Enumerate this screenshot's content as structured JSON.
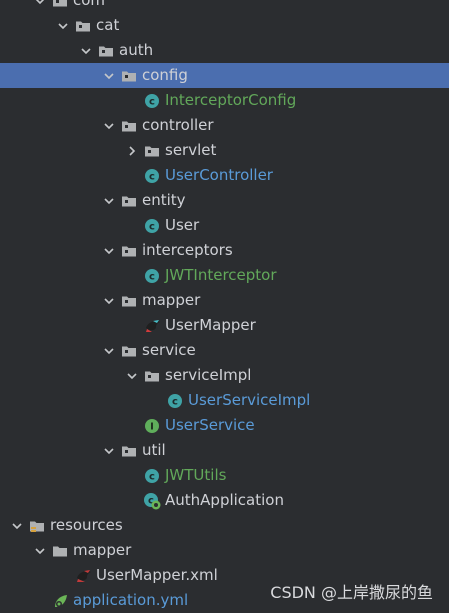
{
  "colors": {
    "background": "#2b2d30",
    "selection": "#4b6eaf",
    "text": "#cfd1d6",
    "file_blue": "#5a9bd8",
    "file_green": "#62a85a",
    "class_icon": "#3fa3a6",
    "interface_icon": "#5fae5b"
  },
  "tree": [
    {
      "label": "com",
      "depth": 1,
      "expanded": true,
      "icon": "package-folder-icon",
      "color": "default"
    },
    {
      "label": "cat",
      "depth": 2,
      "expanded": true,
      "icon": "package-folder-icon",
      "color": "default"
    },
    {
      "label": "auth",
      "depth": 3,
      "expanded": true,
      "icon": "package-folder-icon",
      "color": "default"
    },
    {
      "label": "config",
      "depth": 4,
      "expanded": true,
      "icon": "package-folder-icon",
      "color": "default",
      "selected": true
    },
    {
      "label": "InterceptorConfig",
      "depth": 5,
      "icon": "class-icon",
      "color": "green"
    },
    {
      "label": "controller",
      "depth": 4,
      "expanded": true,
      "icon": "package-folder-icon",
      "color": "default"
    },
    {
      "label": "servlet",
      "depth": 5,
      "expanded": false,
      "icon": "package-folder-icon",
      "color": "default"
    },
    {
      "label": "UserController",
      "depth": 5,
      "icon": "class-icon",
      "color": "blue"
    },
    {
      "label": "entity",
      "depth": 4,
      "expanded": true,
      "icon": "package-folder-icon",
      "color": "default"
    },
    {
      "label": "User",
      "depth": 5,
      "icon": "class-icon",
      "color": "default"
    },
    {
      "label": "interceptors",
      "depth": 4,
      "expanded": true,
      "icon": "package-folder-icon",
      "color": "default"
    },
    {
      "label": "JWTInterceptor",
      "depth": 5,
      "icon": "class-icon",
      "color": "green"
    },
    {
      "label": "mapper",
      "depth": 4,
      "expanded": true,
      "icon": "package-folder-icon",
      "color": "default"
    },
    {
      "label": "UserMapper",
      "depth": 5,
      "icon": "mybatis-mapper-icon",
      "color": "default"
    },
    {
      "label": "service",
      "depth": 4,
      "expanded": true,
      "icon": "package-folder-icon",
      "color": "default"
    },
    {
      "label": "serviceImpl",
      "depth": 5,
      "expanded": true,
      "icon": "package-folder-icon",
      "color": "default"
    },
    {
      "label": "UserServiceImpl",
      "depth": 6,
      "icon": "class-icon",
      "color": "blue"
    },
    {
      "label": "UserService",
      "depth": 5,
      "icon": "interface-icon",
      "color": "blue"
    },
    {
      "label": "util",
      "depth": 4,
      "expanded": true,
      "icon": "package-folder-icon",
      "color": "default"
    },
    {
      "label": "JWTUtils",
      "depth": 5,
      "icon": "class-icon",
      "color": "green"
    },
    {
      "label": "AuthApplication",
      "depth": 5,
      "icon": "spring-boot-class-icon",
      "color": "default",
      "icon_shift": -1
    },
    {
      "label": "resources",
      "depth": 0,
      "expanded": true,
      "icon": "resources-folder-icon",
      "color": "default"
    },
    {
      "label": "mapper",
      "depth": 1,
      "expanded": true,
      "icon": "folder-icon",
      "color": "default"
    },
    {
      "label": "UserMapper.xml",
      "depth": 2,
      "icon": "mybatis-xml-icon",
      "color": "default"
    },
    {
      "label": "application.yml",
      "depth": 1,
      "icon": "spring-yml-icon",
      "color": "blue"
    }
  ],
  "watermark": "CSDN @上岸撒尿的鱼"
}
